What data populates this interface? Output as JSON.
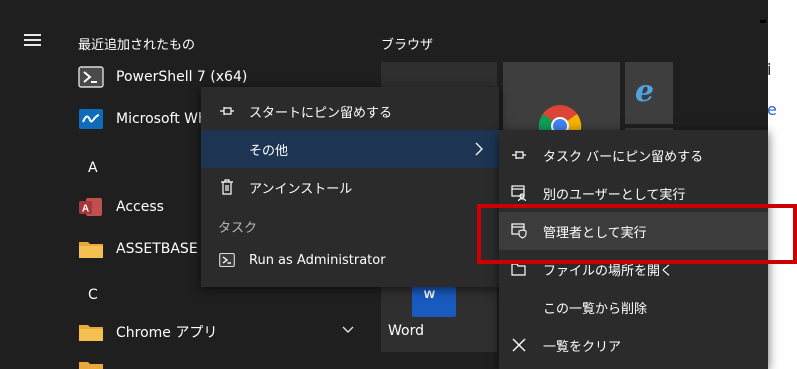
{
  "start_menu": {
    "recent_header": "最近追加されたもの",
    "tiles_header": "ブラウザ",
    "apps": [
      {
        "label": "PowerShell 7 (x64)",
        "icon": "powershell-icon"
      },
      {
        "label": "Microsoft Whi",
        "icon": "whiteboard-icon"
      },
      {
        "label": "Access",
        "icon": "access-icon"
      },
      {
        "label": "ASSETBASE",
        "icon": "folder-icon"
      },
      {
        "label": "Chrome アプリ",
        "icon": "folder-icon"
      }
    ],
    "letters": [
      "A",
      "C"
    ],
    "tiles": {
      "word_label": "Word"
    }
  },
  "context_menu": {
    "items": [
      {
        "label": "スタートにピン留めする",
        "icon": "pin-icon"
      },
      {
        "label": "その他",
        "icon": "chevron-right-icon"
      },
      {
        "label": "アンインストール",
        "icon": "trash-icon"
      }
    ],
    "section_label": "タスク",
    "task": {
      "label": "Run as Administrator",
      "icon": "powershell-icon"
    }
  },
  "submenu": {
    "items": [
      {
        "label": "タスク バーにピン留めする",
        "icon": "pin-icon"
      },
      {
        "label": "別のユーザーとして実行",
        "icon": "run-as-user-icon"
      },
      {
        "label": "管理者として実行",
        "icon": "run-as-admin-icon"
      },
      {
        "label": "ファイルの場所を開く",
        "icon": "open-location-icon"
      },
      {
        "label": "この一覧から削除",
        "icon": ""
      },
      {
        "label": "一覧をクリア",
        "icon": "close-icon"
      }
    ]
  },
  "colors": {
    "menu_bg": "#2b2b2b",
    "selected_bg": "#1d3553",
    "highlight_bg": "#3c3c3c",
    "annotation": "#cc0000"
  }
}
